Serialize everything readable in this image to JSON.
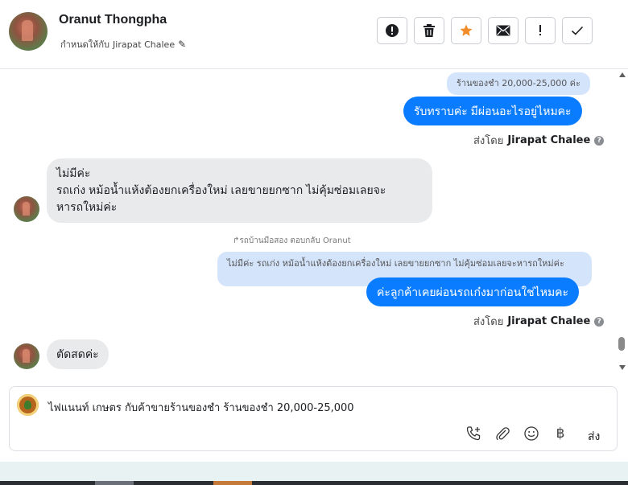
{
  "header": {
    "contact_name": "Oranut Thongpha",
    "assign_prefix": "กำหนดให้กับ",
    "assignee": "Jirapat Chalee",
    "actions": [
      "spam-icon",
      "trash-icon",
      "star-icon",
      "mail-icon",
      "exclamation-icon",
      "check-icon"
    ],
    "star_color": "#f28c28"
  },
  "messages": {
    "m1_quote": "ร้านของชำ 20,000-25,000 ค่ะ",
    "m1_text": "รับทราบค่ะ มีผ่อนอะไรอยู่ไหมคะ",
    "m1_sent_prefix": "ส่งโดย",
    "m1_sent_by": "Jirapat Chalee",
    "m2_line1": "ไม่มีค่ะ",
    "m2_line2": "รถเก่ง หม้อน้ำแห้งต้องยกเครื่องใหม่ เลยขายยกซาก ไม่คุ้มซ่อมเลยจะ",
    "m2_line3": "หารถใหม่ค่ะ",
    "reply_note": "รถบ้านมือสอง ตอบกลับ Oranut",
    "m3_quote": "ไม่มีค่ะ รถเก่ง หม้อน้ำแห้งต้องยกเครื่องใหม่ เลยขายยกซาก ไม่คุ้มซ่อมเลยจะหารถใหม่ค่ะ",
    "m3_text": "ค่ะลูกค้าเคยผ่อนรถเก๋งมาก่อนใช่ไหมคะ",
    "m3_sent_prefix": "ส่งโดย",
    "m3_sent_by": "Jirapat Chalee",
    "m4_text": "ตัดสดค่ะ"
  },
  "composer": {
    "text": "ไฟแนนท์ เกษตร กับค้าขายร้านของชำ ร้านของชำ 20,000-25,000",
    "tools": [
      "phone-add-icon",
      "attach-icon",
      "emoji-icon",
      "baht-icon"
    ],
    "send_label": "ส่ง"
  },
  "colors": {
    "outgoing": "#0a7cff",
    "quote": "#d4e4fb",
    "incoming": "#e9eaec"
  }
}
